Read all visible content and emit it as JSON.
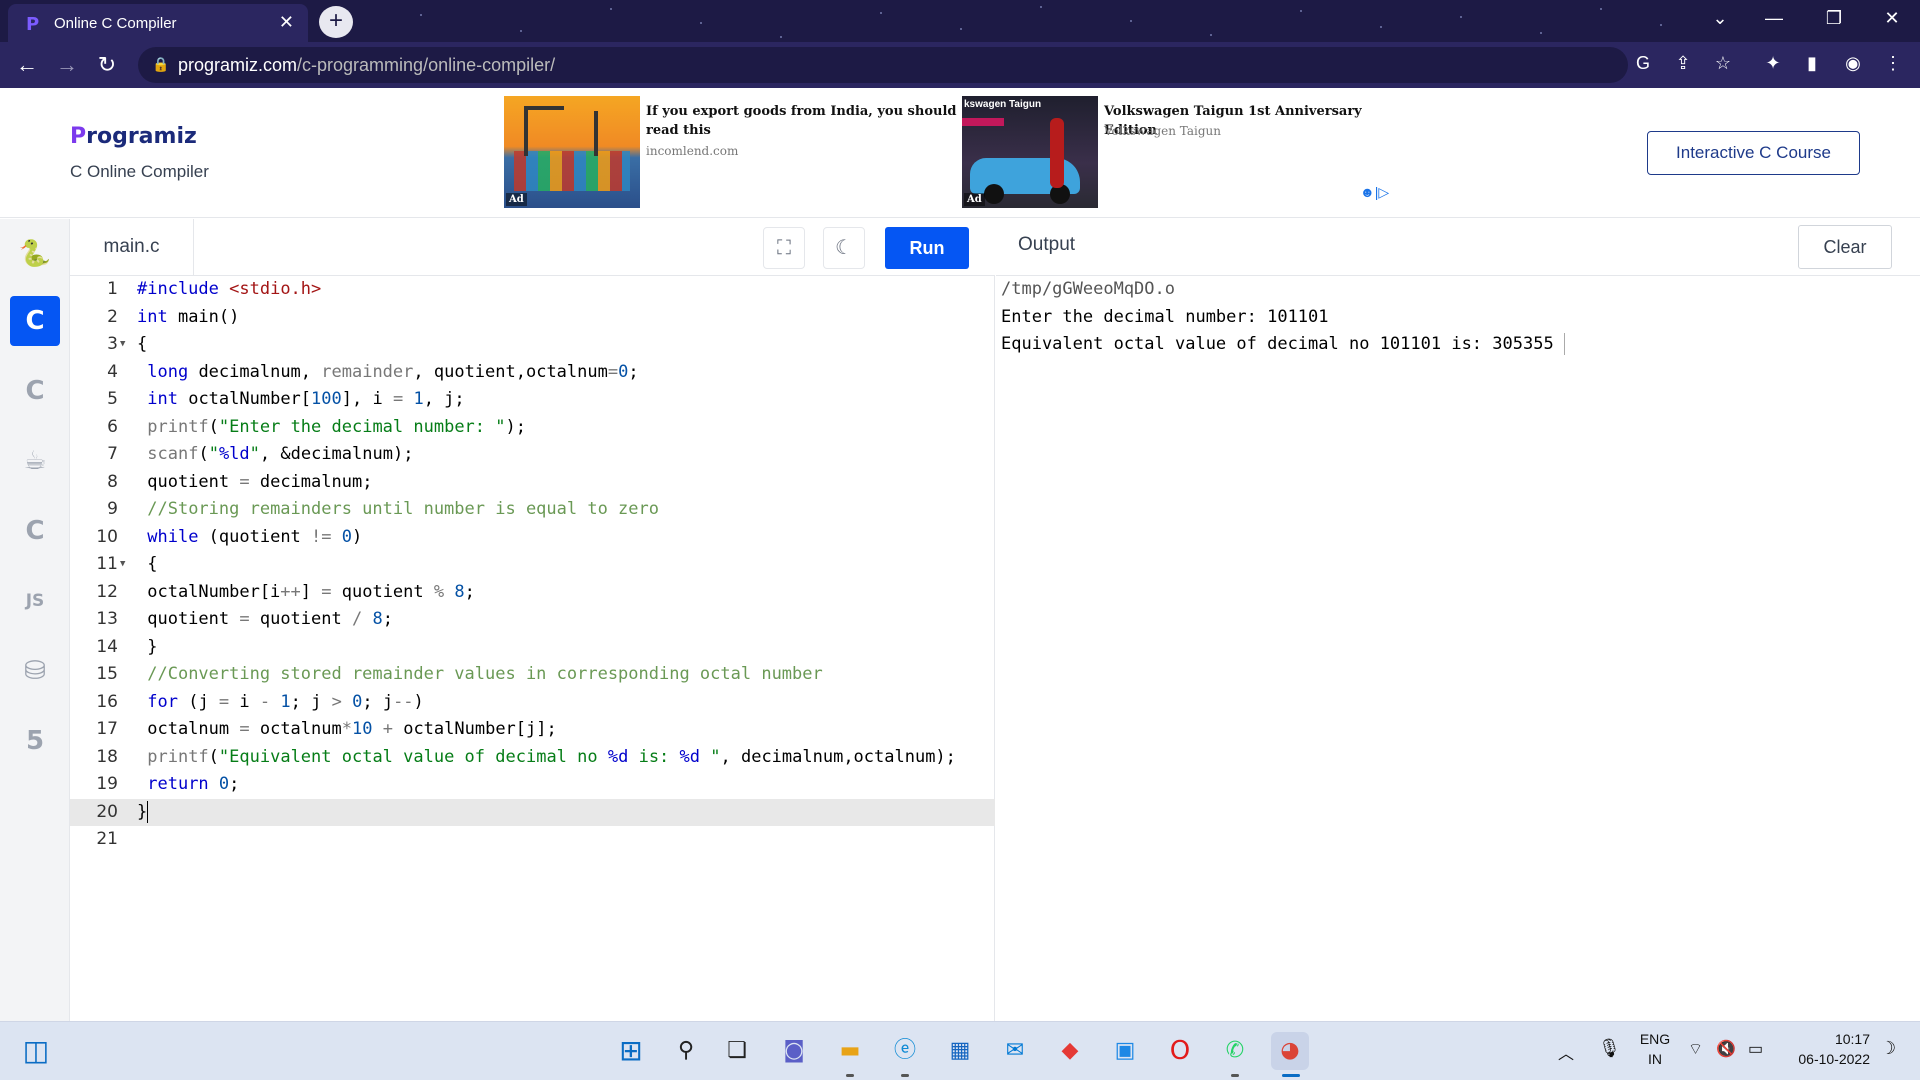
{
  "browser": {
    "tab_title": "Online C Compiler",
    "url_host": "programiz.com",
    "url_path": "/c-programming/online-compiler/"
  },
  "site": {
    "logo": "rogramiz",
    "logo_initial": "P",
    "subtitle": "C Online Compiler",
    "course_button": "Interactive C Course"
  },
  "ads": [
    {
      "headline": "If you export goods from India, you should read this",
      "source": "incomlend.com",
      "label": "Ad"
    },
    {
      "headline": "Volkswagen Taigun 1st Anniversary Edition",
      "source": "Volkswagen Taigun",
      "label": "Ad",
      "image_text": "kswagen Taigun"
    }
  ],
  "sidebar": {
    "items": [
      {
        "name": "python",
        "glyph": "🐍"
      },
      {
        "name": "c",
        "glyph": "C",
        "active": true
      },
      {
        "name": "cpp",
        "glyph": "C"
      },
      {
        "name": "java",
        "glyph": "☕"
      },
      {
        "name": "csharp",
        "glyph": "C"
      },
      {
        "name": "javascript",
        "glyph": "JS"
      },
      {
        "name": "sql",
        "glyph": "⛁"
      },
      {
        "name": "html",
        "glyph": "5"
      }
    ]
  },
  "editor": {
    "file_name": "main.c",
    "run_label": "Run",
    "active_line": 20,
    "lines": [
      "#include <stdio.h>",
      "int main()",
      "{",
      " long decimalnum, remainder, quotient,octalnum=0;",
      " int octalNumber[100], i = 1, j;",
      " printf(\"Enter the decimal number: \");",
      " scanf(\"%ld\", &decimalnum);",
      " quotient = decimalnum;",
      " //Storing remainders until number is equal to zero",
      " while (quotient != 0)",
      " {",
      " octalNumber[i++] = quotient % 8;",
      " quotient = quotient / 8;",
      " }",
      " //Converting stored remainder values in corresponding octal number",
      " for (j = i - 1; j > 0; j--)",
      " octalnum = octalnum*10 + octalNumber[j];",
      " printf(\"Equivalent octal value of decimal no %d is: %d \", decimalnum,octalnum);",
      " return 0;",
      "}",
      ""
    ]
  },
  "output": {
    "label": "Output",
    "clear_label": "Clear",
    "lines": [
      "/tmp/gGWeeoMqDO.o",
      "Enter the decimal number: 101101",
      "Equivalent octal value of decimal no 101101 is: 305355"
    ]
  },
  "taskbar": {
    "language": "ENG",
    "region": "IN",
    "time": "10:17",
    "date": "06-10-2022"
  }
}
